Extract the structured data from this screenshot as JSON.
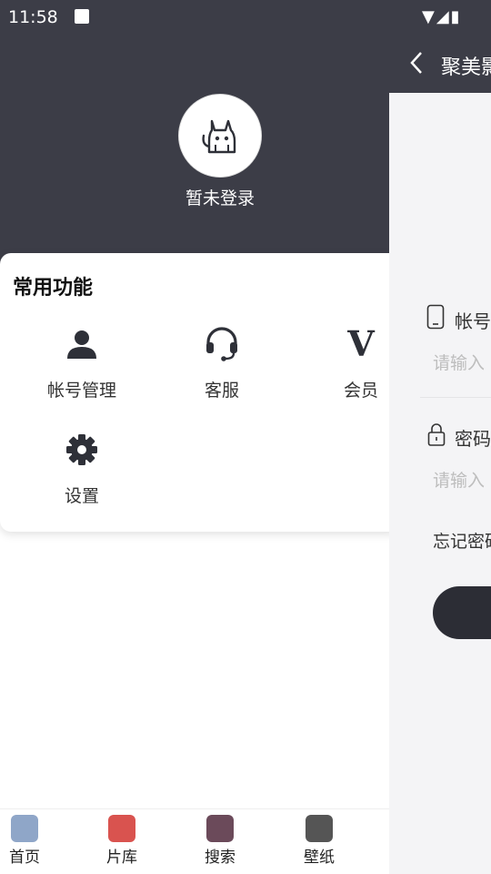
{
  "status_bar": {
    "time": "11:58",
    "right_icons": "▼◢▮"
  },
  "drawer": {
    "login_status": "暂未登录",
    "avatar_icon": "cat-icon",
    "section_title": "常用功能",
    "functions": [
      {
        "label": "帐号管理",
        "icon": "person-icon"
      },
      {
        "label": "客服",
        "icon": "headset-icon"
      },
      {
        "label": "会员",
        "icon": "vip-icon",
        "glyph": "V"
      },
      {
        "label": "设置",
        "icon": "gear-icon"
      }
    ],
    "bottom_nav": [
      {
        "label": "首页",
        "color": "#8fa6c8"
      },
      {
        "label": "片库",
        "color": "#d9534f"
      },
      {
        "label": "搜索",
        "color": "#6b4a5a"
      },
      {
        "label": "壁纸",
        "color": "#555555"
      }
    ]
  },
  "login_page": {
    "title": "聚美影",
    "account_label": "帐号",
    "account_placeholder": "请输入",
    "password_label": "密码",
    "password_placeholder": "请输入",
    "forgot_text": "忘记密码"
  },
  "colors": {
    "header_bg": "#3c3d47",
    "accent": "#2c2d35"
  }
}
